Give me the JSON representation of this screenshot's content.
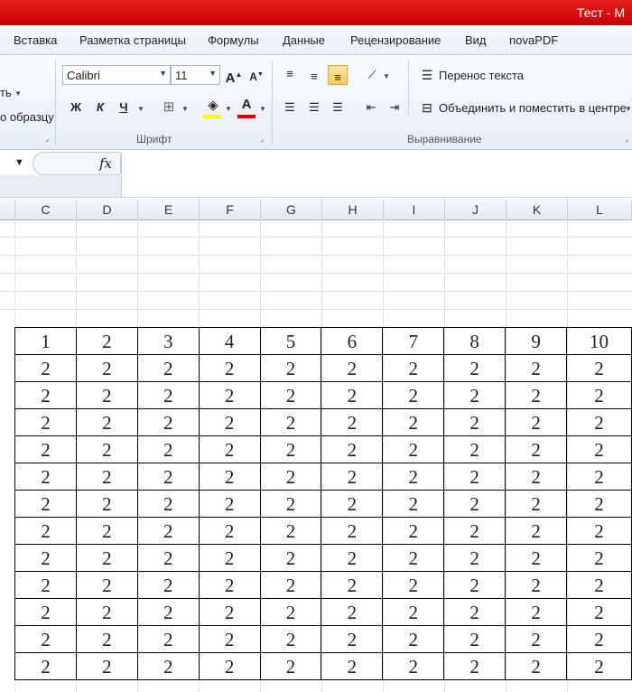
{
  "window": {
    "title": "Тест  -  M"
  },
  "tabs": [
    "Вставка",
    "Разметка страницы",
    "Формулы",
    "Данные",
    "Рецензирование",
    "Вид",
    "novaPDF"
  ],
  "clipboard": {
    "cut_partial": "ть",
    "format_painter_partial": "о образцу"
  },
  "font_group": {
    "label": "Шрифт",
    "font_name": "Calibri",
    "font_size": "11",
    "grow": "A",
    "shrink": "A",
    "bold": "Ж",
    "italic": "К",
    "underline": "Ч",
    "font_color_letter": "A",
    "highlight_color": "#ffff00",
    "font_color": "#e00000"
  },
  "align_group": {
    "label": "Выравнивание",
    "wrap_text": "Перенос текста",
    "merge_center": "Объединить и поместить в центре"
  },
  "formula_bar": {
    "fx": "fx",
    "value": ""
  },
  "columns": [
    "C",
    "D",
    "E",
    "F",
    "G",
    "H",
    "I",
    "J",
    "K",
    "L"
  ],
  "table": {
    "header": [
      "1",
      "2",
      "3",
      "4",
      "5",
      "6",
      "7",
      "8",
      "9",
      "10"
    ],
    "rows": [
      [
        "2",
        "2",
        "2",
        "2",
        "2",
        "2",
        "2",
        "2",
        "2",
        "2"
      ],
      [
        "2",
        "2",
        "2",
        "2",
        "2",
        "2",
        "2",
        "2",
        "2",
        "2"
      ],
      [
        "2",
        "2",
        "2",
        "2",
        "2",
        "2",
        "2",
        "2",
        "2",
        "2"
      ],
      [
        "2",
        "2",
        "2",
        "2",
        "2",
        "2",
        "2",
        "2",
        "2",
        "2"
      ],
      [
        "2",
        "2",
        "2",
        "2",
        "2",
        "2",
        "2",
        "2",
        "2",
        "2"
      ],
      [
        "2",
        "2",
        "2",
        "2",
        "2",
        "2",
        "2",
        "2",
        "2",
        "2"
      ],
      [
        "2",
        "2",
        "2",
        "2",
        "2",
        "2",
        "2",
        "2",
        "2",
        "2"
      ],
      [
        "2",
        "2",
        "2",
        "2",
        "2",
        "2",
        "2",
        "2",
        "2",
        "2"
      ],
      [
        "2",
        "2",
        "2",
        "2",
        "2",
        "2",
        "2",
        "2",
        "2",
        "2"
      ],
      [
        "2",
        "2",
        "2",
        "2",
        "2",
        "2",
        "2",
        "2",
        "2",
        "2"
      ],
      [
        "2",
        "2",
        "2",
        "2",
        "2",
        "2",
        "2",
        "2",
        "2",
        "2"
      ],
      [
        "2",
        "2",
        "2",
        "2",
        "2",
        "2",
        "2",
        "2",
        "2",
        "2"
      ]
    ]
  }
}
